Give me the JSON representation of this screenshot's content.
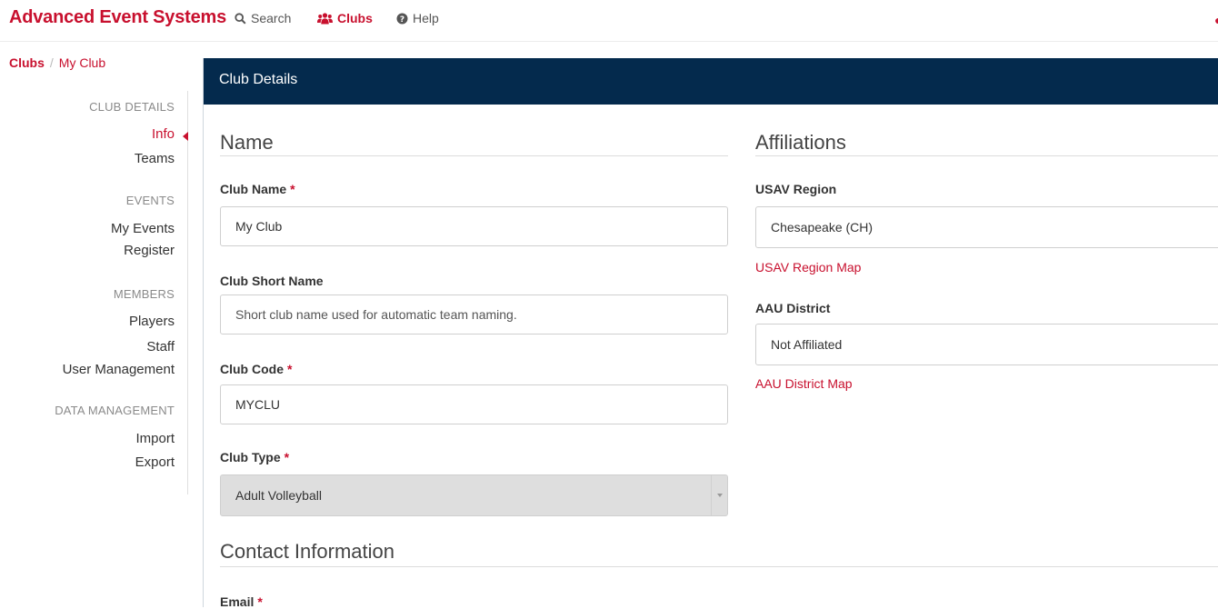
{
  "nav": {
    "brand": "Advanced Event Systems",
    "links": [
      {
        "label": "Search",
        "icon": "search-icon"
      },
      {
        "label": "Clubs",
        "icon": "users-icon",
        "active": true
      },
      {
        "label": "Help",
        "icon": "question-circle-icon"
      }
    ]
  },
  "breadcrumb": {
    "root": "Clubs",
    "separator": "/",
    "current": "My Club"
  },
  "sidebar": {
    "groups": [
      {
        "heading": "CLUB DETAILS",
        "items": [
          "Info",
          "Teams"
        ]
      },
      {
        "heading": "EVENTS",
        "items": [
          "My Events",
          "Register"
        ]
      },
      {
        "heading": "MEMBERS",
        "items": [
          "Players",
          "Staff",
          "User Management"
        ]
      },
      {
        "heading": "DATA MANAGEMENT",
        "items": [
          "Import",
          "Export"
        ]
      }
    ],
    "active_item": "Info"
  },
  "panel": {
    "title": "Club Details",
    "name_section": {
      "title": "Name",
      "club_name": {
        "label": "Club Name",
        "required": "*",
        "value": "My Club"
      },
      "club_short_name": {
        "label": "Club Short Name",
        "value": "",
        "placeholder": "Short club name used for automatic team naming."
      },
      "club_code": {
        "label": "Club Code",
        "required": "*",
        "value": "MYCLU"
      },
      "club_type": {
        "label": "Club Type",
        "required": "*",
        "value": "Adult Volleyball"
      }
    },
    "affiliations": {
      "title": "Affiliations",
      "usav_region": {
        "label": "USAV Region",
        "value": "Chesapeake (CH)",
        "map_link": "USAV Region Map"
      },
      "aau_district": {
        "label": "AAU District",
        "value": "Not Affiliated",
        "map_link": "AAU District Map"
      }
    },
    "contact": {
      "title": "Contact Information",
      "email": {
        "label": "Email",
        "required": "*"
      }
    }
  },
  "colors": {
    "brand": "#c8102e",
    "header": "#042a4d"
  }
}
